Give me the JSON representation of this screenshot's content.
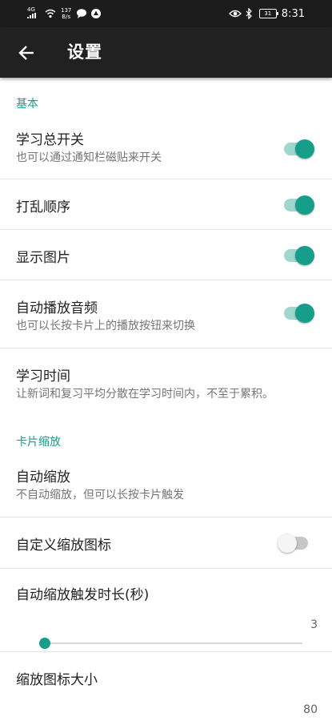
{
  "status_bar": {
    "signal": "4G",
    "net_speed_value": "137",
    "net_speed_unit": "B/s",
    "battery": "31",
    "time": "8:31"
  },
  "app_bar": {
    "back_icon": "arrow-back-icon",
    "title": "设置"
  },
  "sections": {
    "basic": {
      "header": "基本"
    },
    "card_zoom": {
      "header": "卡片缩放"
    }
  },
  "settings": {
    "study_switch": {
      "title": "学习总开关",
      "summary": "也可以通过通知栏磁贴来开关",
      "enabled": true
    },
    "shuffle": {
      "title": "打乱顺序",
      "enabled": true
    },
    "show_images": {
      "title": "显示图片",
      "enabled": true
    },
    "autoplay_audio": {
      "title": "自动播放音频",
      "summary": "也可以长按卡片上的播放按钮来切换",
      "enabled": true
    },
    "study_time": {
      "title": "学习时间",
      "summary": "让新词和复习平均分散在学习时间内，不至于累积。"
    },
    "auto_zoom": {
      "title": "自动缩放",
      "summary": "不自动缩放，但可以长按卡片触发"
    },
    "custom_zoom_icon": {
      "title": "自定义缩放图标",
      "enabled": false
    },
    "auto_zoom_duration": {
      "title": "自动缩放触发时长(秒)",
      "value": "3"
    },
    "zoom_icon_size": {
      "title": "缩放图标大小",
      "value": "80"
    }
  },
  "colors": {
    "accent": "#169e8a",
    "app_bar": "#212121",
    "status_bar": "#1c1c1c"
  }
}
